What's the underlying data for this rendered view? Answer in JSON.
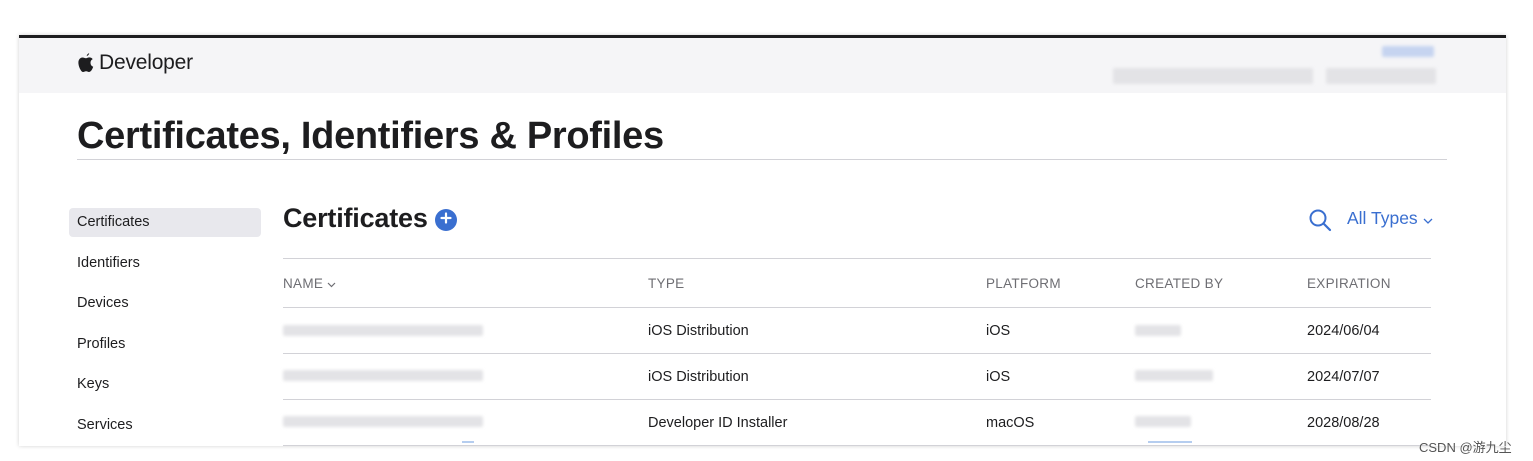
{
  "header": {
    "brand": "Developer",
    "brand_icon": "apple-logo-icon"
  },
  "page": {
    "title": "Certificates, Identifiers & Profiles"
  },
  "sidebar": {
    "items": [
      {
        "label": "Certificates",
        "active": true
      },
      {
        "label": "Identifiers",
        "active": false
      },
      {
        "label": "Devices",
        "active": false
      },
      {
        "label": "Profiles",
        "active": false
      },
      {
        "label": "Keys",
        "active": false
      },
      {
        "label": "Services",
        "active": false
      }
    ]
  },
  "section": {
    "title": "Certificates",
    "add_icon": "plus-circle-icon",
    "search_icon": "search-icon",
    "filter_label": "All Types"
  },
  "table": {
    "columns": [
      "NAME",
      "TYPE",
      "PLATFORM",
      "CREATED BY",
      "EXPIRATION"
    ],
    "rows": [
      {
        "type": "iOS Distribution",
        "platform": "iOS",
        "expiration": "2024/06/04"
      },
      {
        "type": "iOS Distribution",
        "platform": "iOS",
        "expiration": "2024/07/07"
      },
      {
        "type": "Developer ID Installer",
        "platform": "macOS",
        "expiration": "2028/08/28"
      }
    ]
  },
  "watermark": "CSDN @游九尘",
  "colors": {
    "accent": "#3a6fd0",
    "topbar_bg": "#f5f5f7",
    "text": "#1d1d1f",
    "muted_text": "#6e6e73",
    "active_item_bg": "#e8e8ed",
    "divider": "#d2d2d7"
  }
}
